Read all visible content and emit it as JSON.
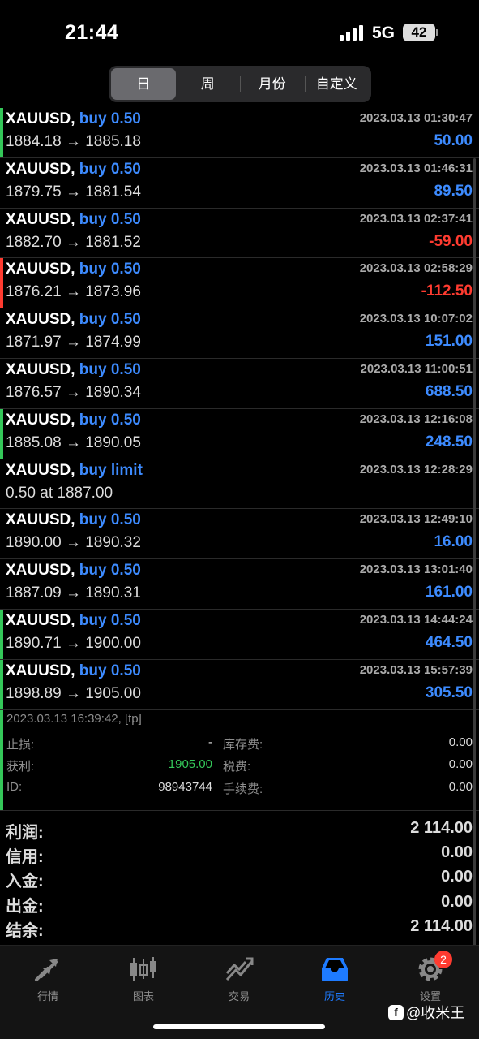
{
  "status": {
    "time": "21:44",
    "network": "5G",
    "battery": "42"
  },
  "segments": [
    {
      "label": "日",
      "active": true
    },
    {
      "label": "周",
      "active": false
    },
    {
      "label": "月份",
      "active": false
    },
    {
      "label": "自定义",
      "active": false
    }
  ],
  "colors": {
    "buy": "#3d8bff",
    "loss": "#ff3b30",
    "green_marker": "#34c759",
    "red_marker": "#ff3b30"
  },
  "trades": [
    {
      "symbol": "XAUUSD,",
      "type": "buy 0.50",
      "time": "2023.03.13 01:30:47",
      "prices": "1884.18 → 1885.18",
      "profit": "50.00",
      "marker": "green"
    },
    {
      "symbol": "XAUUSD,",
      "type": "buy 0.50",
      "time": "2023.03.13 01:46:31",
      "prices": "1879.75 → 1881.54",
      "profit": "89.50",
      "marker": ""
    },
    {
      "symbol": "XAUUSD,",
      "type": "buy 0.50",
      "time": "2023.03.13 02:37:41",
      "prices": "1882.70 → 1881.52",
      "profit": "-59.00",
      "marker": ""
    },
    {
      "symbol": "XAUUSD,",
      "type": "buy 0.50",
      "time": "2023.03.13 02:58:29",
      "prices": "1876.21 → 1873.96",
      "profit": "-112.50",
      "marker": "red"
    },
    {
      "symbol": "XAUUSD,",
      "type": "buy 0.50",
      "time": "2023.03.13 10:07:02",
      "prices": "1871.97 → 1874.99",
      "profit": "151.00",
      "marker": ""
    },
    {
      "symbol": "XAUUSD,",
      "type": "buy 0.50",
      "time": "2023.03.13 11:00:51",
      "prices": "1876.57 → 1890.34",
      "profit": "688.50",
      "marker": ""
    },
    {
      "symbol": "XAUUSD,",
      "type": "buy 0.50",
      "time": "2023.03.13 12:16:08",
      "prices": "1885.08 → 1890.05",
      "profit": "248.50",
      "marker": "green"
    },
    {
      "symbol": "XAUUSD,",
      "type": "buy limit",
      "time": "2023.03.13 12:28:29",
      "prices": "0.50 at 1887.00",
      "profit": "",
      "marker": ""
    },
    {
      "symbol": "XAUUSD,",
      "type": "buy 0.50",
      "time": "2023.03.13 12:49:10",
      "prices": "1890.00 → 1890.32",
      "profit": "16.00",
      "marker": ""
    },
    {
      "symbol": "XAUUSD,",
      "type": "buy 0.50",
      "time": "2023.03.13 13:01:40",
      "prices": "1887.09 → 1890.31",
      "profit": "161.00",
      "marker": ""
    },
    {
      "symbol": "XAUUSD,",
      "type": "buy 0.50",
      "time": "2023.03.13 14:44:24",
      "prices": "1890.71 → 1900.00",
      "profit": "464.50",
      "marker": "green"
    },
    {
      "symbol": "XAUUSD,",
      "type": "buy 0.50",
      "time": "2023.03.13 15:57:39",
      "prices": "1898.89 → 1905.00",
      "profit": "305.50",
      "marker": "green"
    }
  ],
  "details": {
    "meta": "2023.03.13 16:39:42, [tp]",
    "stop_loss_label": "止损:",
    "stop_loss": "-",
    "swap_label": "库存费:",
    "swap": "0.00",
    "take_profit_label": "获利:",
    "take_profit": "1905.00",
    "tax_label": "税费:",
    "tax": "0.00",
    "id_label": "ID:",
    "id": "98943744",
    "commission_label": "手续费:",
    "commission": "0.00"
  },
  "summary": [
    {
      "label": "利润:",
      "value": "2 114.00"
    },
    {
      "label": "信用:",
      "value": "0.00"
    },
    {
      "label": "入金:",
      "value": "0.00"
    },
    {
      "label": "出金:",
      "value": "0.00"
    },
    {
      "label": "结余:",
      "value": "2 114.00"
    }
  ],
  "tabs": [
    {
      "label": "行情",
      "icon": "quotes-arrows-icon",
      "active": false
    },
    {
      "label": "图表",
      "icon": "candlestick-chart-icon",
      "active": false
    },
    {
      "label": "交易",
      "icon": "trade-trend-icon",
      "active": false
    },
    {
      "label": "历史",
      "icon": "history-tray-icon",
      "active": true
    },
    {
      "label": "设置",
      "icon": "gear-icon",
      "active": false,
      "badge": "2"
    }
  ],
  "watermark": "@收米王"
}
